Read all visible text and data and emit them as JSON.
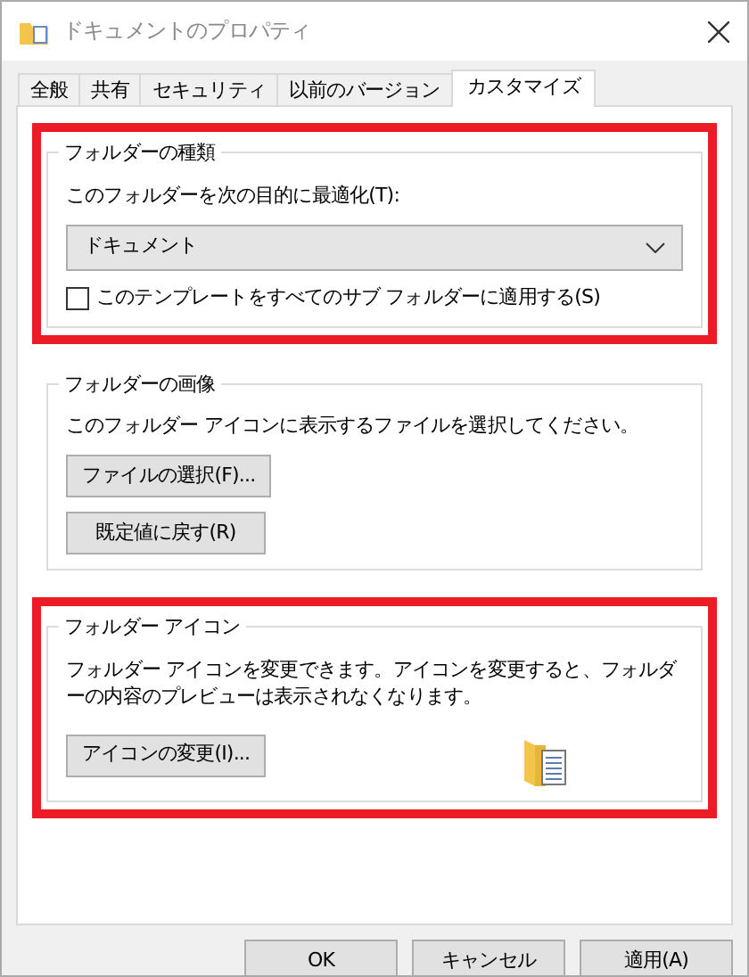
{
  "window": {
    "title": "ドキュメントのプロパティ"
  },
  "tabs": [
    {
      "label": "全般",
      "selected": false
    },
    {
      "label": "共有",
      "selected": false
    },
    {
      "label": "セキュリティ",
      "selected": false
    },
    {
      "label": "以前のバージョン",
      "selected": false
    },
    {
      "label": "カスタマイズ",
      "selected": true
    }
  ],
  "groups": [
    {
      "kind": "folder_type",
      "title": "フォルダーの種類",
      "highlighted": true,
      "label": "このフォルダーを次の目的に最適化(T):",
      "dropdown": {
        "value": "ドキュメント"
      },
      "checkbox": {
        "label": "このテンプレートをすべてのサブ フォルダーに適用する(S)",
        "checked": false
      }
    },
    {
      "kind": "folder_picture",
      "title": "フォルダーの画像",
      "highlighted": false,
      "text": "このフォルダー アイコンに表示するファイルを選択してください。",
      "buttons": [
        "ファイルの選択(F)...",
        "既定値に戻す(R)"
      ]
    },
    {
      "kind": "folder_icon",
      "title": "フォルダー アイコン",
      "highlighted": true,
      "text": "フォルダー アイコンを変更できます。アイコンを変更すると、フォルダーの内容のプレビューは表示されなくなります。",
      "buttons": [
        "アイコンの変更(I)..."
      ]
    }
  ],
  "buttons": [
    "OK",
    "キャンセル",
    "適用(A)"
  ]
}
